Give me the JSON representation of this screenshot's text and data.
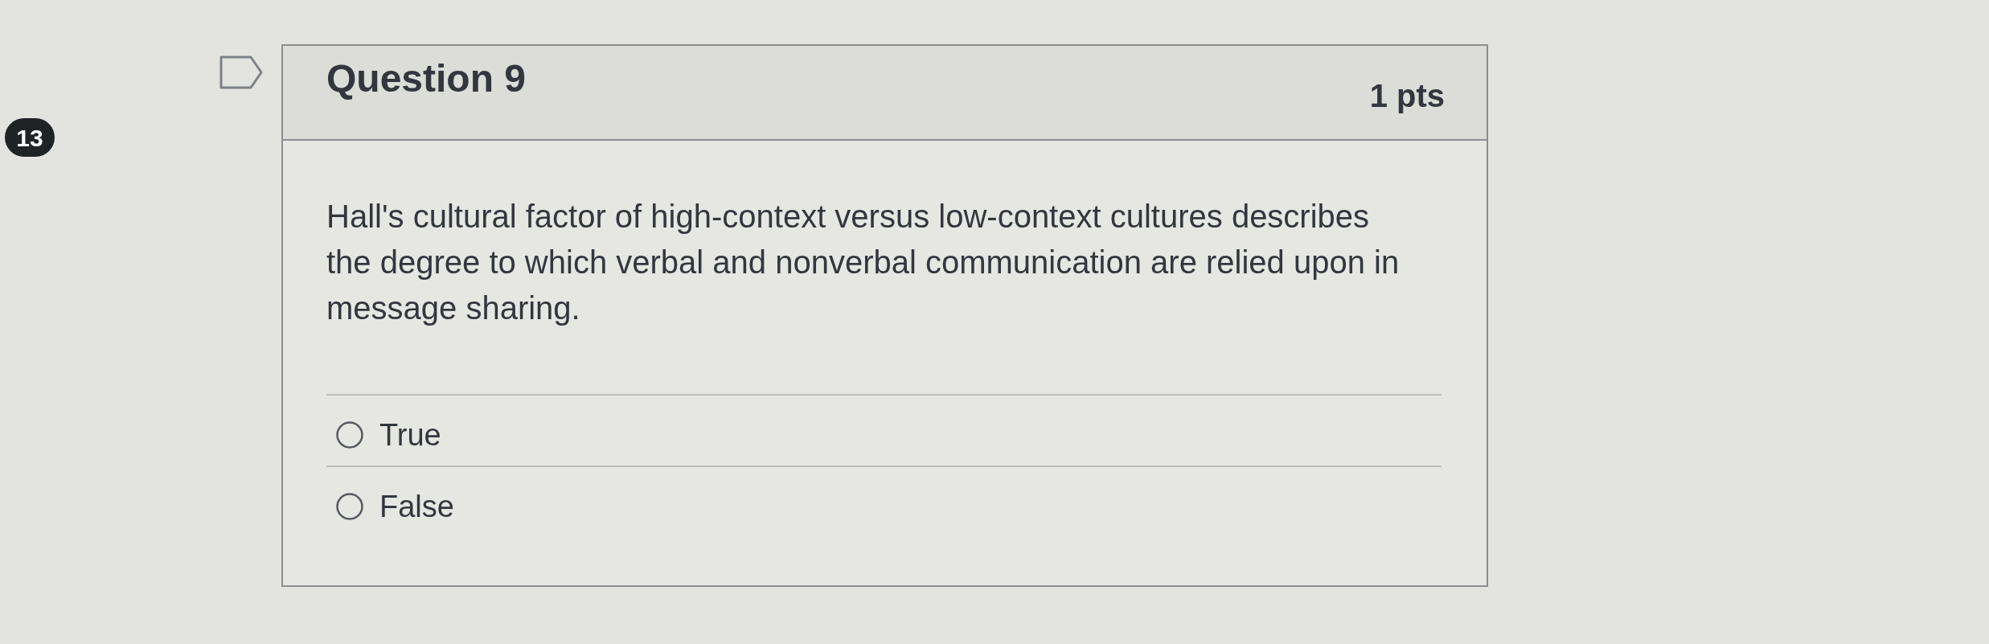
{
  "badge": "13",
  "question": {
    "flagged": false,
    "title": "Question 9",
    "points": "1 pts",
    "text": "Hall's cultural factor of high-context versus low-context cultures describes the degree to which verbal and nonverbal communication are relied upon in message sharing.",
    "answers": [
      {
        "label": "True",
        "selected": false
      },
      {
        "label": "False",
        "selected": false
      }
    ]
  }
}
